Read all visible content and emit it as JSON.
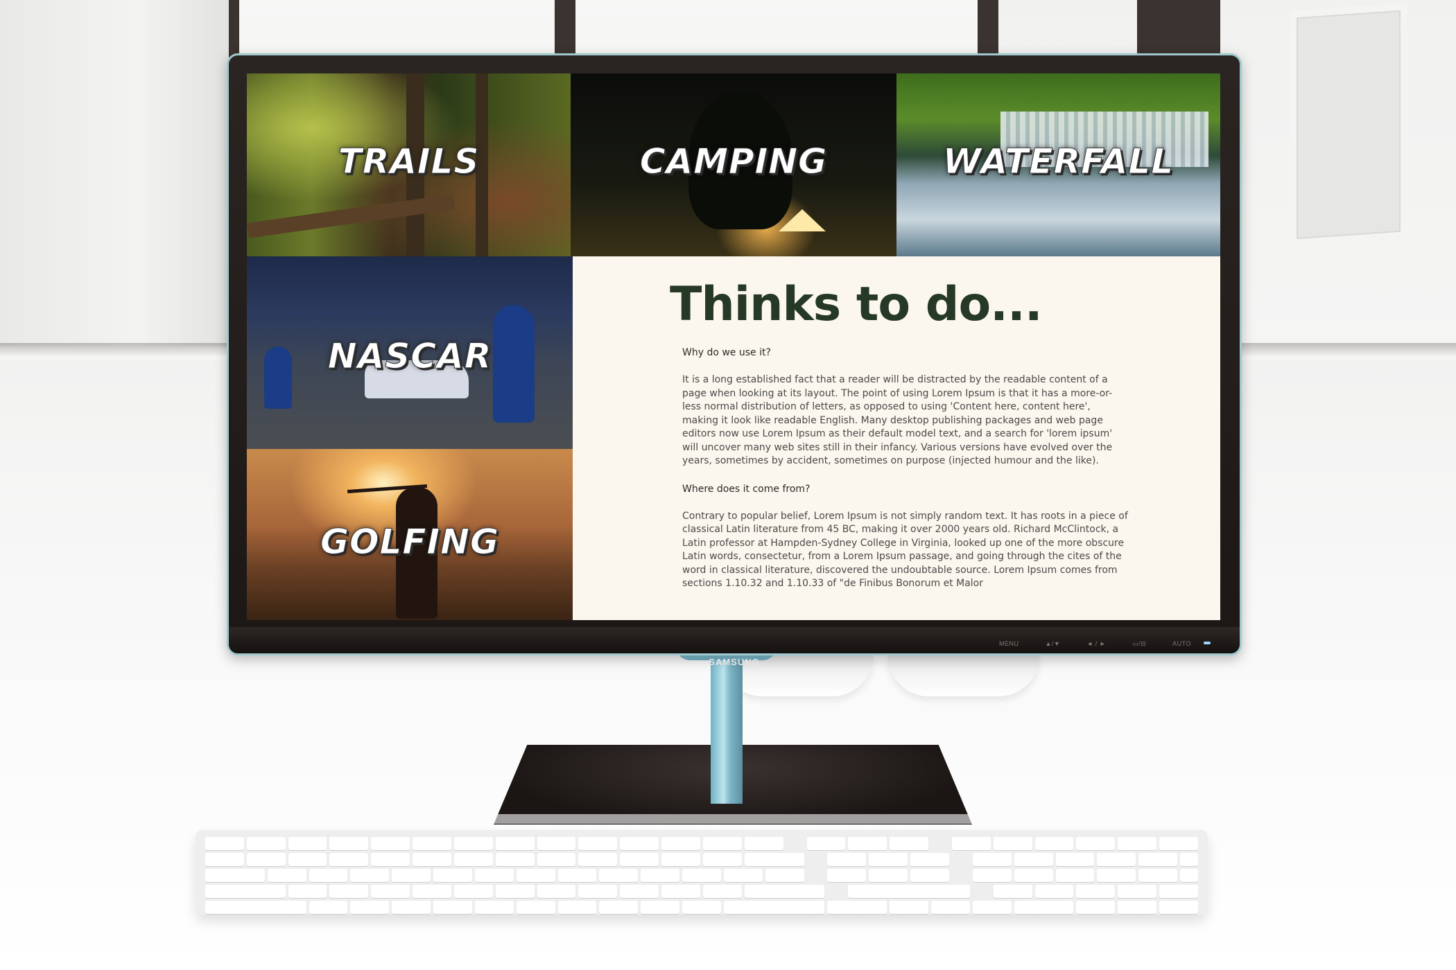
{
  "tiles": [
    {
      "id": "trails",
      "label": "TRAILS"
    },
    {
      "id": "camping",
      "label": "CAMPING"
    },
    {
      "id": "waterfall",
      "label": "WATERFALL"
    },
    {
      "id": "nascar",
      "label": "NASCAR"
    },
    {
      "id": "golfing",
      "label": "GOLFING"
    }
  ],
  "content": {
    "title": "Thinks to do...",
    "sections": [
      {
        "heading": "Why do we use it?",
        "body": "It is a long established fact that a reader will be distracted by the readable content of a page when looking at its layout. The point of using Lorem Ipsum is that it has a more-or-less normal distribution of letters, as opposed to using 'Content here, content here', making it look like readable English. Many desktop publishing packages and web page editors now use Lorem Ipsum as their default model text, and a search for 'lorem ipsum' will uncover many web sites still in their infancy. Various versions have evolved over the years, sometimes by accident, sometimes on purpose (injected humour and the like)."
      },
      {
        "heading": "Where does it come from?",
        "body": "Contrary to popular belief, Lorem Ipsum is not simply random text. It has roots in a piece of classical Latin literature from 45 BC, making it over 2000 years old. Richard McClintock, a Latin professor at Hampden-Sydney College in Virginia, looked up one of the more obscure Latin words, consectetur, from a Lorem Ipsum passage, and going through the cites of the word in classical literature, discovered the undoubtable source. Lorem Ipsum comes from sections 1.10.32 and 1.10.33 of \"de Finibus Bonorum et Malor"
      }
    ]
  },
  "monitor": {
    "brand": "SAMSUNG",
    "buttons": [
      "MENU",
      "▲/▼",
      "◄ / ►",
      "▭/⊟",
      "AUTO"
    ]
  },
  "colors": {
    "title": "#263826",
    "content_bg": "#fbf7ee",
    "bezel_trim": "#9fc9cf"
  }
}
